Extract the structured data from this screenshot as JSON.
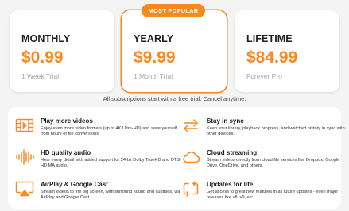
{
  "badge": "MOST POPULAR",
  "plans": [
    {
      "name": "MONTHLY",
      "price": "$0.99",
      "trial": "1 Week Trial"
    },
    {
      "name": "YEARLY",
      "price": "$9.99",
      "trial": "1 Month Trial"
    },
    {
      "name": "LIFETIME",
      "price": "$84.99",
      "trial": "Forever Pro"
    }
  ],
  "note": "All subscriptions start with a free trial. Cancel anytime.",
  "features": [
    {
      "icon": "film-icon",
      "title": "Play more videos",
      "desc": "Enjoy even more video formats (up to 4K Ultra-HD) and save yourself from hours of file conversions."
    },
    {
      "icon": "sync-arrows-icon",
      "title": "Stay in sync",
      "desc": "Keep your library, playback progress, and watched history in sync with other devices."
    },
    {
      "icon": "waveform-icon",
      "title": "HD quality audio",
      "desc": "Hear every detail with added support for 24-bit Dolby TrueHD and DTS-HD MA audio."
    },
    {
      "icon": "cloud-icon",
      "title": "Cloud streaming",
      "desc": "Stream videos directly from cloud file services like Dropbox, Google Drive, OneDrive, and others."
    },
    {
      "icon": "airplay-icon",
      "title": "AirPlay & Google Cast",
      "desc": "Stream videos to the big screen, with surround sound and subtitles, via AirPlay and Google Cast."
    },
    {
      "icon": "updates-icon",
      "title": "Updates for life",
      "desc": "Get access to great new features in all future updates - even major releases like v8, v9, etc..."
    }
  ],
  "colors": {
    "accent": "#f7891f",
    "background": "#f4f4f5",
    "card": "#ffffff"
  }
}
